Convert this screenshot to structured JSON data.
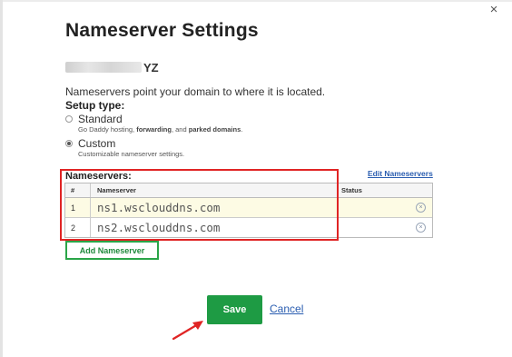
{
  "dialog": {
    "title": "Nameserver Settings",
    "close_glyph": "×",
    "domain_suffix": "YZ",
    "description": "Nameservers point your domain to where it is located.",
    "setup_type_label": "Setup type:"
  },
  "setup_options": {
    "standard": {
      "label": "Standard",
      "checked": false,
      "desc_parts": [
        "Go Daddy hosting",
        ", ",
        "forwarding",
        ", and ",
        "parked domains",
        "."
      ]
    },
    "custom": {
      "label": "Custom",
      "checked": true,
      "description": "Customizable nameserver settings."
    }
  },
  "nameservers": {
    "label": "Nameservers:",
    "edit_link": "Edit Nameservers",
    "columns": {
      "num": "#",
      "name": "Nameserver",
      "status": "Status"
    },
    "rows": [
      {
        "num": "1",
        "value": "ns1.wsclouddns.com"
      },
      {
        "num": "2",
        "value": "ns2.wsclouddns.com"
      }
    ],
    "remove_glyph": "×",
    "add_button": "Add Nameserver"
  },
  "actions": {
    "save": "Save",
    "cancel": "Cancel"
  },
  "colors": {
    "save_green": "#1e9b44",
    "annotation_red": "#e02424",
    "link_blue": "#2a5db0",
    "row_highlight": "#fdfbe4"
  },
  "icons": {
    "close": "close-icon",
    "remove": "remove-circle-icon",
    "annotation_arrow": "arrow-annotation-icon"
  }
}
